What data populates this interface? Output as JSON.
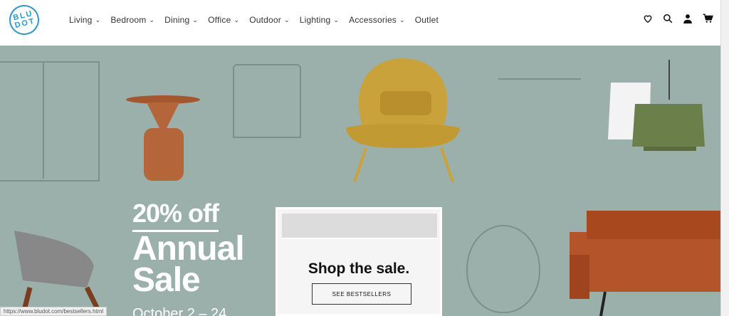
{
  "brand": {
    "logo_lines": [
      "BLU",
      "DOT"
    ]
  },
  "nav": {
    "items": [
      {
        "label": "Living"
      },
      {
        "label": "Bedroom"
      },
      {
        "label": "Dining"
      },
      {
        "label": "Office"
      },
      {
        "label": "Outdoor"
      },
      {
        "label": "Lighting"
      },
      {
        "label": "Accessories"
      },
      {
        "label": "Outlet"
      }
    ]
  },
  "header_icons": [
    "heart-icon",
    "search-icon",
    "account-icon",
    "cart-icon"
  ],
  "promo": {
    "discount": "20% off",
    "title_line1": "Annual",
    "title_line2": "Sale",
    "date": "October 2 – 24"
  },
  "panel": {
    "headline": "Shop the sale.",
    "button": "SEE BESTSELLERS"
  },
  "status_bar": "https://www.bludot.com/bestsellers.html",
  "colors": {
    "accent": "#2e9ac6",
    "hero_bg": "#9bb0ab"
  }
}
